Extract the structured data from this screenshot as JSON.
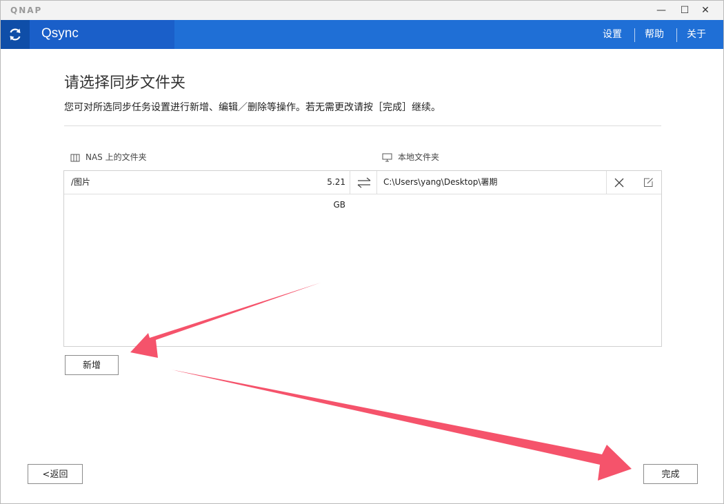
{
  "window": {
    "brand": "QNAP",
    "controls": {
      "minimize": "—",
      "maximize": "☐",
      "close": "✕"
    }
  },
  "header": {
    "app_name": "Qsync",
    "menu": [
      "设置",
      "帮助",
      "关于"
    ]
  },
  "main": {
    "title": "请选择同步文件夹",
    "description": "您可对所选同步任务设置进行新增、编辑／删除等操作。若无需更改请按［完成］继续。",
    "columns": {
      "nas": "NAS 上的文件夹",
      "local": "本地文件夹"
    },
    "rows": [
      {
        "nas_folder": "/图片",
        "size": "5.21 GB",
        "local_folder": "C:\\Users\\yang\\Desktop\\署期"
      }
    ],
    "add_label": "新增"
  },
  "footer": {
    "back_label": "<返回",
    "done_label": "完成"
  },
  "colors": {
    "accent": "#1f6fd6",
    "accent_dark": "#0f4ea8",
    "annotation_arrow": "#f5536b"
  },
  "icons": [
    "sync-icon",
    "nas-icon",
    "monitor-icon",
    "sync-direction-icon",
    "delete-icon",
    "edit-icon"
  ]
}
